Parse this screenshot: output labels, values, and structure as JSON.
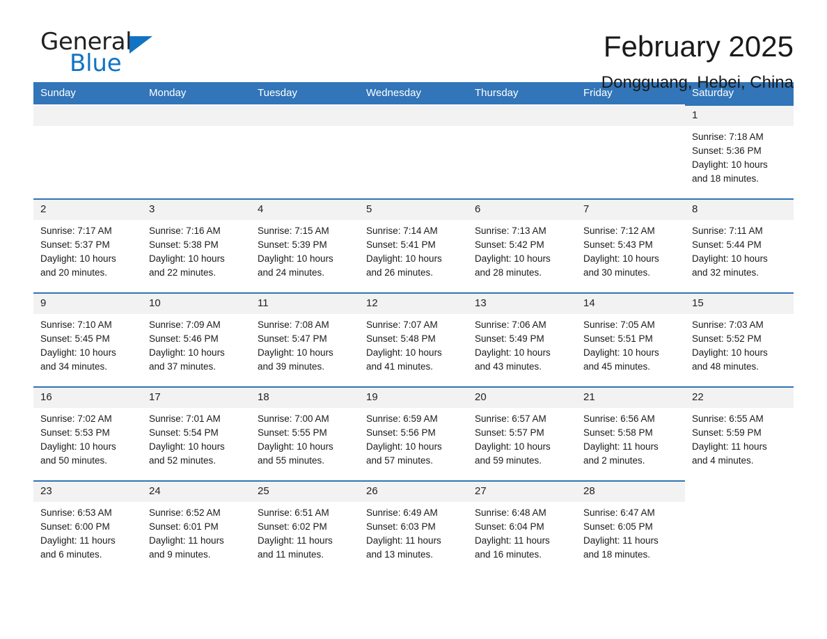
{
  "brand": {
    "name_part1": "General",
    "name_part2": "Blue",
    "triangle_color": "#1273c4",
    "logo_icon": "general-blue-logo"
  },
  "header": {
    "title": "February 2025",
    "subtitle": "Dongguang, Hebei, China"
  },
  "theme": {
    "header_bg": "#3275b8",
    "cell_top_border": "#2f74b5",
    "daynum_bg": "#f2f2f2",
    "text": "#1a1a1a"
  },
  "weekdays": [
    "Sunday",
    "Monday",
    "Tuesday",
    "Wednesday",
    "Thursday",
    "Friday",
    "Saturday"
  ],
  "weeks": [
    [
      {
        "day": "",
        "empty": true,
        "sunrise": "",
        "sunset": "",
        "daylight_line1": "",
        "daylight_line2": ""
      },
      {
        "day": "",
        "empty": true,
        "sunrise": "",
        "sunset": "",
        "daylight_line1": "",
        "daylight_line2": ""
      },
      {
        "day": "",
        "empty": true,
        "sunrise": "",
        "sunset": "",
        "daylight_line1": "",
        "daylight_line2": ""
      },
      {
        "day": "",
        "empty": true,
        "sunrise": "",
        "sunset": "",
        "daylight_line1": "",
        "daylight_line2": ""
      },
      {
        "day": "",
        "empty": true,
        "sunrise": "",
        "sunset": "",
        "daylight_line1": "",
        "daylight_line2": ""
      },
      {
        "day": "",
        "empty": true,
        "sunrise": "",
        "sunset": "",
        "daylight_line1": "",
        "daylight_line2": ""
      },
      {
        "day": "1",
        "empty": false,
        "sunrise": "Sunrise: 7:18 AM",
        "sunset": "Sunset: 5:36 PM",
        "daylight_line1": "Daylight: 10 hours",
        "daylight_line2": "and 18 minutes."
      }
    ],
    [
      {
        "day": "2",
        "empty": false,
        "sunrise": "Sunrise: 7:17 AM",
        "sunset": "Sunset: 5:37 PM",
        "daylight_line1": "Daylight: 10 hours",
        "daylight_line2": "and 20 minutes."
      },
      {
        "day": "3",
        "empty": false,
        "sunrise": "Sunrise: 7:16 AM",
        "sunset": "Sunset: 5:38 PM",
        "daylight_line1": "Daylight: 10 hours",
        "daylight_line2": "and 22 minutes."
      },
      {
        "day": "4",
        "empty": false,
        "sunrise": "Sunrise: 7:15 AM",
        "sunset": "Sunset: 5:39 PM",
        "daylight_line1": "Daylight: 10 hours",
        "daylight_line2": "and 24 minutes."
      },
      {
        "day": "5",
        "empty": false,
        "sunrise": "Sunrise: 7:14 AM",
        "sunset": "Sunset: 5:41 PM",
        "daylight_line1": "Daylight: 10 hours",
        "daylight_line2": "and 26 minutes."
      },
      {
        "day": "6",
        "empty": false,
        "sunrise": "Sunrise: 7:13 AM",
        "sunset": "Sunset: 5:42 PM",
        "daylight_line1": "Daylight: 10 hours",
        "daylight_line2": "and 28 minutes."
      },
      {
        "day": "7",
        "empty": false,
        "sunrise": "Sunrise: 7:12 AM",
        "sunset": "Sunset: 5:43 PM",
        "daylight_line1": "Daylight: 10 hours",
        "daylight_line2": "and 30 minutes."
      },
      {
        "day": "8",
        "empty": false,
        "sunrise": "Sunrise: 7:11 AM",
        "sunset": "Sunset: 5:44 PM",
        "daylight_line1": "Daylight: 10 hours",
        "daylight_line2": "and 32 minutes."
      }
    ],
    [
      {
        "day": "9",
        "empty": false,
        "sunrise": "Sunrise: 7:10 AM",
        "sunset": "Sunset: 5:45 PM",
        "daylight_line1": "Daylight: 10 hours",
        "daylight_line2": "and 34 minutes."
      },
      {
        "day": "10",
        "empty": false,
        "sunrise": "Sunrise: 7:09 AM",
        "sunset": "Sunset: 5:46 PM",
        "daylight_line1": "Daylight: 10 hours",
        "daylight_line2": "and 37 minutes."
      },
      {
        "day": "11",
        "empty": false,
        "sunrise": "Sunrise: 7:08 AM",
        "sunset": "Sunset: 5:47 PM",
        "daylight_line1": "Daylight: 10 hours",
        "daylight_line2": "and 39 minutes."
      },
      {
        "day": "12",
        "empty": false,
        "sunrise": "Sunrise: 7:07 AM",
        "sunset": "Sunset: 5:48 PM",
        "daylight_line1": "Daylight: 10 hours",
        "daylight_line2": "and 41 minutes."
      },
      {
        "day": "13",
        "empty": false,
        "sunrise": "Sunrise: 7:06 AM",
        "sunset": "Sunset: 5:49 PM",
        "daylight_line1": "Daylight: 10 hours",
        "daylight_line2": "and 43 minutes."
      },
      {
        "day": "14",
        "empty": false,
        "sunrise": "Sunrise: 7:05 AM",
        "sunset": "Sunset: 5:51 PM",
        "daylight_line1": "Daylight: 10 hours",
        "daylight_line2": "and 45 minutes."
      },
      {
        "day": "15",
        "empty": false,
        "sunrise": "Sunrise: 7:03 AM",
        "sunset": "Sunset: 5:52 PM",
        "daylight_line1": "Daylight: 10 hours",
        "daylight_line2": "and 48 minutes."
      }
    ],
    [
      {
        "day": "16",
        "empty": false,
        "sunrise": "Sunrise: 7:02 AM",
        "sunset": "Sunset: 5:53 PM",
        "daylight_line1": "Daylight: 10 hours",
        "daylight_line2": "and 50 minutes."
      },
      {
        "day": "17",
        "empty": false,
        "sunrise": "Sunrise: 7:01 AM",
        "sunset": "Sunset: 5:54 PM",
        "daylight_line1": "Daylight: 10 hours",
        "daylight_line2": "and 52 minutes."
      },
      {
        "day": "18",
        "empty": false,
        "sunrise": "Sunrise: 7:00 AM",
        "sunset": "Sunset: 5:55 PM",
        "daylight_line1": "Daylight: 10 hours",
        "daylight_line2": "and 55 minutes."
      },
      {
        "day": "19",
        "empty": false,
        "sunrise": "Sunrise: 6:59 AM",
        "sunset": "Sunset: 5:56 PM",
        "daylight_line1": "Daylight: 10 hours",
        "daylight_line2": "and 57 minutes."
      },
      {
        "day": "20",
        "empty": false,
        "sunrise": "Sunrise: 6:57 AM",
        "sunset": "Sunset: 5:57 PM",
        "daylight_line1": "Daylight: 10 hours",
        "daylight_line2": "and 59 minutes."
      },
      {
        "day": "21",
        "empty": false,
        "sunrise": "Sunrise: 6:56 AM",
        "sunset": "Sunset: 5:58 PM",
        "daylight_line1": "Daylight: 11 hours",
        "daylight_line2": "and 2 minutes."
      },
      {
        "day": "22",
        "empty": false,
        "sunrise": "Sunrise: 6:55 AM",
        "sunset": "Sunset: 5:59 PM",
        "daylight_line1": "Daylight: 11 hours",
        "daylight_line2": "and 4 minutes."
      }
    ],
    [
      {
        "day": "23",
        "empty": false,
        "sunrise": "Sunrise: 6:53 AM",
        "sunset": "Sunset: 6:00 PM",
        "daylight_line1": "Daylight: 11 hours",
        "daylight_line2": "and 6 minutes."
      },
      {
        "day": "24",
        "empty": false,
        "sunrise": "Sunrise: 6:52 AM",
        "sunset": "Sunset: 6:01 PM",
        "daylight_line1": "Daylight: 11 hours",
        "daylight_line2": "and 9 minutes."
      },
      {
        "day": "25",
        "empty": false,
        "sunrise": "Sunrise: 6:51 AM",
        "sunset": "Sunset: 6:02 PM",
        "daylight_line1": "Daylight: 11 hours",
        "daylight_line2": "and 11 minutes."
      },
      {
        "day": "26",
        "empty": false,
        "sunrise": "Sunrise: 6:49 AM",
        "sunset": "Sunset: 6:03 PM",
        "daylight_line1": "Daylight: 11 hours",
        "daylight_line2": "and 13 minutes."
      },
      {
        "day": "27",
        "empty": false,
        "sunrise": "Sunrise: 6:48 AM",
        "sunset": "Sunset: 6:04 PM",
        "daylight_line1": "Daylight: 11 hours",
        "daylight_line2": "and 16 minutes."
      },
      {
        "day": "28",
        "empty": false,
        "sunrise": "Sunrise: 6:47 AM",
        "sunset": "Sunset: 6:05 PM",
        "daylight_line1": "Daylight: 11 hours",
        "daylight_line2": "and 18 minutes."
      },
      {
        "day": "",
        "empty": true,
        "sunrise": "",
        "sunset": "",
        "daylight_line1": "",
        "daylight_line2": ""
      }
    ]
  ]
}
